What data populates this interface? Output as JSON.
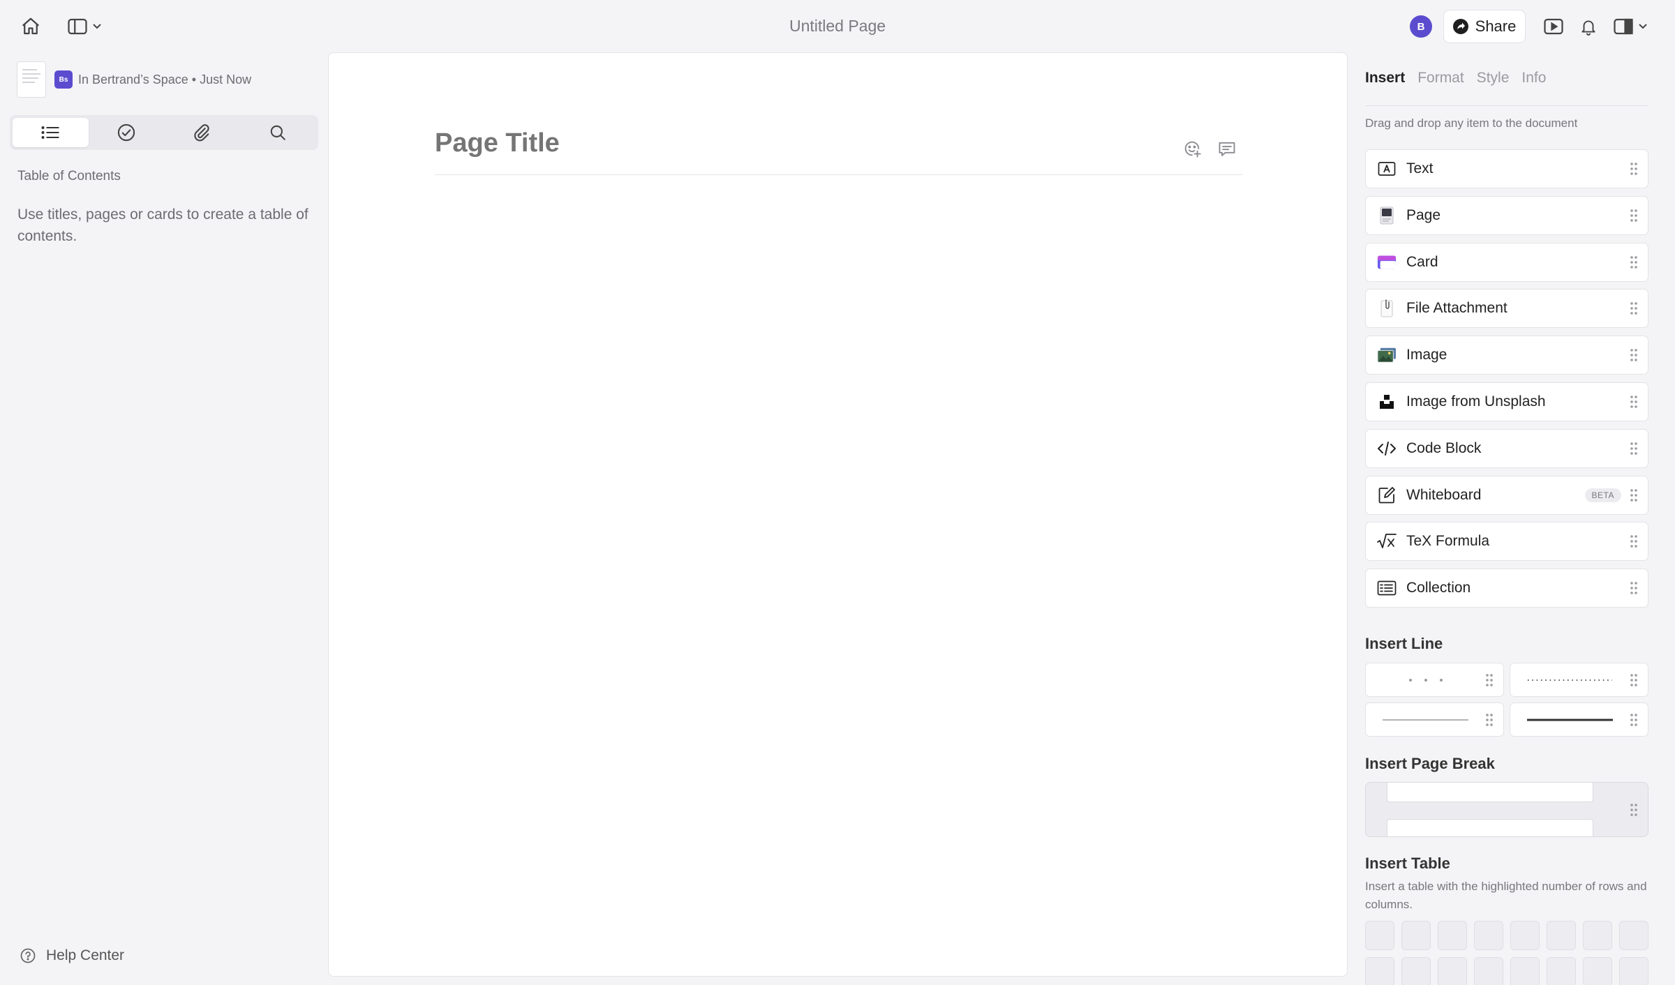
{
  "window": {
    "title": "Untitled Page"
  },
  "topbar": {
    "home_icon": "house-icon",
    "sidebar_icon": "sidebar-icon",
    "avatar_initial": "B",
    "share_label": "Share",
    "present_icon": "play-icon",
    "notifications_icon": "bell-icon",
    "inspector_icon": "inspector-panel-icon"
  },
  "sidebar": {
    "meta": "In Bertrand’s Space • Just Now",
    "space_badge": "Bs",
    "tabs": [
      {
        "name": "table-of-contents",
        "icon": "list-icon",
        "active": true
      },
      {
        "name": "tasks",
        "icon": "checkmark-circle-icon",
        "active": false
      },
      {
        "name": "attachments",
        "icon": "paperclip-icon",
        "active": false
      },
      {
        "name": "search",
        "icon": "search-icon",
        "active": false
      }
    ],
    "toc_heading": "Table of Contents",
    "toc_empty": "Use titles, pages or cards to create a table of contents.",
    "help": "Help Center"
  },
  "document": {
    "title_placeholder": "Page Title",
    "title_value": ""
  },
  "inspector": {
    "tabs": [
      "Insert",
      "Format",
      "Style",
      "Info"
    ],
    "active_tab": "Insert",
    "hint": "Drag and drop any item to the document",
    "items": [
      {
        "label": "Text",
        "icon": "text-box-icon"
      },
      {
        "label": "Page",
        "icon": "page-icon"
      },
      {
        "label": "Card",
        "icon": "card-icon"
      },
      {
        "label": "File Attachment",
        "icon": "file-attachment-icon"
      },
      {
        "label": "Image",
        "icon": "image-icon"
      },
      {
        "label": "Image from Unsplash",
        "icon": "unsplash-icon"
      },
      {
        "label": "Code Block",
        "icon": "code-icon"
      },
      {
        "label": "Whiteboard",
        "icon": "whiteboard-icon",
        "badge": "BETA"
      },
      {
        "label": "TeX Formula",
        "icon": "sqrt-icon"
      },
      {
        "label": "Collection",
        "icon": "collection-icon"
      }
    ],
    "insert_line": "Insert Line",
    "line_styles": [
      "dots-wide",
      "dots-fine",
      "thin-line",
      "thick-line"
    ],
    "insert_page_break": "Insert Page Break",
    "insert_table": "Insert Table",
    "insert_table_desc": "Insert a table with the highlighted number of rows and columns."
  },
  "colors": {
    "accent": "#5b4ccf",
    "background": "#f4f4f6",
    "canvas": "#ffffff"
  }
}
